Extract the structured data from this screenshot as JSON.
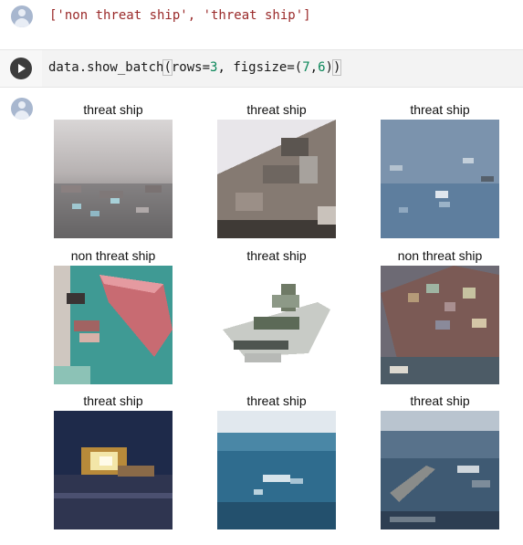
{
  "output": {
    "text": "['non threat ship', 'threat ship']"
  },
  "code_cell": {
    "prefix": "data.show_batch",
    "open_paren": "(",
    "arg1_name": "rows=",
    "arg1_value": "3",
    "sep": ", figsize=(",
    "fig_w": "7",
    "comma": ",",
    "fig_h": "6",
    "close": ")",
    "close_paren": ")"
  },
  "batch": {
    "tiles": [
      {
        "label": "threat ship",
        "scene": "gray-sea-convoy"
      },
      {
        "label": "threat ship",
        "scene": "warship-deck-closeup"
      },
      {
        "label": "threat ship",
        "scene": "blue-sea-fleet"
      },
      {
        "label": "non threat ship",
        "scene": "tanker-harbor"
      },
      {
        "label": "threat ship",
        "scene": "cutout-warship"
      },
      {
        "label": "non threat ship",
        "scene": "container-ship"
      },
      {
        "label": "threat ship",
        "scene": "night-fire"
      },
      {
        "label": "threat ship",
        "scene": "ocean-horizon"
      },
      {
        "label": "threat ship",
        "scene": "dark-sea-ships"
      }
    ]
  },
  "colors": {
    "output_text": "#9a2a2a",
    "number": "#098658",
    "run_button": "#3c3c3c"
  }
}
